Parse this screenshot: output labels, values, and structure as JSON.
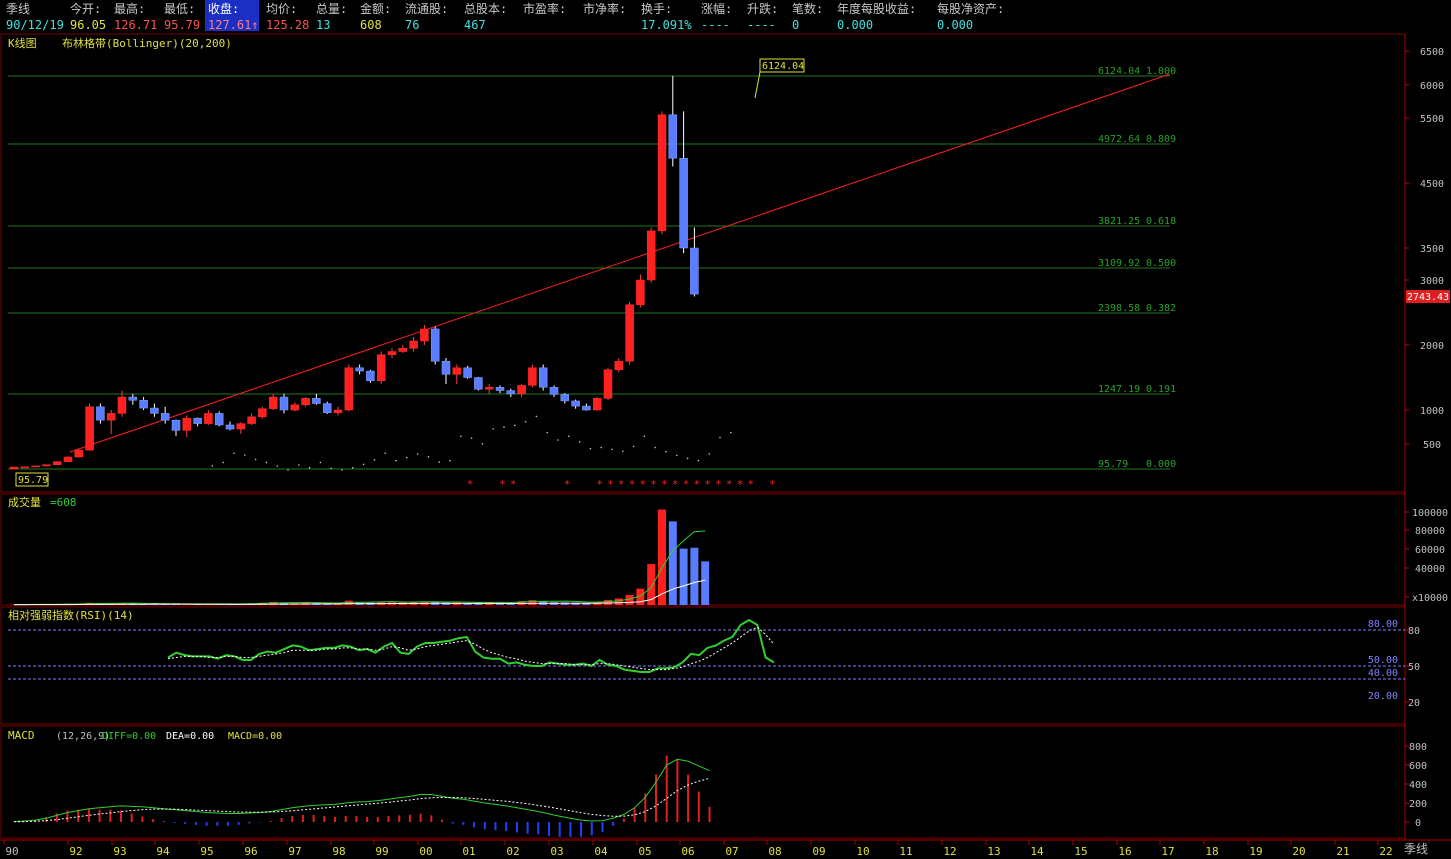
{
  "infobar": {
    "period_label": "季线",
    "fields": [
      {
        "label": "今开:",
        "value": "96.05",
        "color": "#e0e040"
      },
      {
        "label": "最高:",
        "value": "126.71",
        "color": "#ff5050"
      },
      {
        "label": "最低:",
        "value": "95.79",
        "color": "#ff5050"
      },
      {
        "label": "收盘:",
        "value": "127.61↑",
        "color": "#ff5050"
      },
      {
        "label": "均价:",
        "value": "125.28",
        "color": "#ff5050"
      },
      {
        "label": "总量:",
        "value": "13",
        "color": "#40e0e0"
      },
      {
        "label": "金额:",
        "value": "608",
        "color": "#e0e040"
      },
      {
        "label": "流通股:",
        "value": "76",
        "color": "#40e0e0"
      },
      {
        "label": "总股本:",
        "value": "467",
        "color": "#40e0e0"
      },
      {
        "label": "市盈率:",
        "value": "",
        "color": "#40e0e0"
      },
      {
        "label": "市净率:",
        "value": "",
        "color": "#40e0e0"
      },
      {
        "label": "换手:",
        "value": "17.091%",
        "color": "#40e0e0"
      },
      {
        "label": "涨幅:",
        "value": "----",
        "color": "#40e0e0"
      },
      {
        "label": "升跌:",
        "value": "----",
        "color": "#40e0e0"
      },
      {
        "label": "笔数:",
        "value": "0",
        "color": "#40e0e0"
      },
      {
        "label": "年度每股收益:",
        "value": "0.000",
        "color": "#40e0e0"
      },
      {
        "label": "每股净资产:",
        "value": "0.000",
        "color": "#40e0e0"
      }
    ],
    "date": "90/12/19"
  },
  "panels": {
    "kline": {
      "title": "K线图",
      "indicator": "布林格带(Bollinger)(20,200)"
    },
    "volume": {
      "title": "成交量",
      "value": "=608"
    },
    "rsi": {
      "title": "相对强弱指数(RSI)(14)"
    },
    "macd": {
      "title": "MACD",
      "params": "(12,26,9)",
      "diff": "DIFF=0.00",
      "dea": "DEA=0.00",
      "macd": "MACD=0.00"
    }
  },
  "colors": {
    "up": "#ff2020",
    "down": "#5a7cff",
    "trendline": "#ff2020",
    "fib": "#1e7a1e",
    "fib_text": "#2aa02a",
    "axis": "#c0c0c0",
    "rsi_line": "#30d030",
    "grid": "#8080ff"
  },
  "chart_data": [
    {
      "type": "candlestick",
      "name": "kline",
      "x_labels": [
        "90",
        "92",
        "93",
        "94",
        "95",
        "96",
        "97",
        "98",
        "99",
        "00",
        "01",
        "02",
        "03",
        "04",
        "05",
        "06",
        "07",
        "08",
        "09",
        "10",
        "11",
        "12",
        "13",
        "14",
        "15",
        "16",
        "17",
        "18",
        "19",
        "20",
        "21",
        "22"
      ],
      "y_ticks": [
        "6500",
        "6000",
        "5500",
        "4500",
        "3500",
        "3000",
        "2000",
        "1000",
        "500"
      ],
      "price_label": "2743.43",
      "high_label": "6124.04",
      "low_label": "95.79",
      "fib_levels": [
        {
          "value": 6124.04,
          "label": "6124.04",
          "ratio": "1.000"
        },
        {
          "value": 4972.64,
          "label": "4972.64",
          "ratio": "0.809"
        },
        {
          "value": 3821.25,
          "label": "3821.25",
          "ratio": "0.618"
        },
        {
          "value": 3109.92,
          "label": "3109.92",
          "ratio": "0.500"
        },
        {
          "value": 2398.58,
          "label": "2398.58",
          "ratio": "0.382"
        },
        {
          "value": 1247.19,
          "label": "1247.19",
          "ratio": "0.191"
        },
        {
          "value": 95.79,
          "label": "95.79",
          "ratio": "0.000"
        }
      ],
      "candles": [
        [
          96,
          127,
          96,
          128
        ],
        [
          128,
          135,
          125,
          130
        ],
        [
          130,
          150,
          128,
          145
        ],
        [
          145,
          170,
          140,
          165
        ],
        [
          165,
          220,
          160,
          215
        ],
        [
          215,
          300,
          210,
          290
        ],
        [
          290,
          420,
          280,
          400
        ],
        [
          400,
          1100,
          390,
          1050
        ],
        [
          1050,
          1100,
          800,
          850
        ],
        [
          850,
          1000,
          650,
          950
        ],
        [
          950,
          1300,
          900,
          1200
        ],
        [
          1200,
          1250,
          1080,
          1150
        ],
        [
          1150,
          1200,
          1000,
          1030
        ],
        [
          1030,
          1100,
          900,
          950
        ],
        [
          950,
          1050,
          800,
          850
        ],
        [
          850,
          860,
          620,
          700
        ],
        [
          700,
          920,
          600,
          880
        ],
        [
          880,
          890,
          760,
          800
        ],
        [
          800,
          1000,
          780,
          950
        ],
        [
          950,
          980,
          760,
          780
        ],
        [
          780,
          830,
          700,
          720
        ],
        [
          720,
          820,
          650,
          800
        ],
        [
          800,
          950,
          780,
          900
        ],
        [
          900,
          1050,
          870,
          1020
        ],
        [
          1020,
          1250,
          1000,
          1200
        ],
        [
          1200,
          1250,
          950,
          1000
        ],
        [
          1000,
          1120,
          980,
          1080
        ],
        [
          1080,
          1200,
          1050,
          1180
        ],
        [
          1180,
          1250,
          1080,
          1100
        ],
        [
          1100,
          1130,
          940,
          960
        ],
        [
          960,
          1050,
          920,
          1000
        ],
        [
          1000,
          1700,
          980,
          1650
        ],
        [
          1650,
          1700,
          1550,
          1600
        ],
        [
          1600,
          1620,
          1420,
          1450
        ],
        [
          1450,
          1900,
          1400,
          1850
        ],
        [
          1850,
          1950,
          1800,
          1900
        ],
        [
          1900,
          2000,
          1880,
          1950
        ],
        [
          1950,
          2100,
          1900,
          2050
        ],
        [
          2050,
          2250,
          2000,
          2200
        ],
        [
          2200,
          2230,
          1700,
          1750
        ],
        [
          1750,
          1800,
          1400,
          1550
        ],
        [
          1550,
          1700,
          1400,
          1650
        ],
        [
          1650,
          1680,
          1480,
          1500
        ],
        [
          1500,
          1510,
          1300,
          1320
        ],
        [
          1320,
          1400,
          1250,
          1350
        ],
        [
          1350,
          1380,
          1260,
          1300
        ],
        [
          1300,
          1330,
          1200,
          1250
        ],
        [
          1250,
          1400,
          1200,
          1380
        ],
        [
          1380,
          1700,
          1350,
          1650
        ],
        [
          1650,
          1700,
          1300,
          1350
        ],
        [
          1350,
          1380,
          1200,
          1240
        ],
        [
          1240,
          1260,
          1100,
          1140
        ],
        [
          1140,
          1160,
          1020,
          1060
        ],
        [
          1060,
          1100,
          990,
          1000
        ],
        [
          1000,
          1200,
          990,
          1180
        ],
        [
          1180,
          1650,
          1150,
          1620
        ],
        [
          1620,
          1800,
          1580,
          1750
        ],
        [
          1750,
          2600,
          1700,
          2550
        ],
        [
          2550,
          3050,
          2500,
          3000
        ],
        [
          3000,
          3800,
          2950,
          3750
        ],
        [
          3750,
          5600,
          3700,
          5550
        ],
        [
          5550,
          6124,
          4700,
          4800
        ],
        [
          4800,
          5600,
          3400,
          3500
        ],
        [
          3500,
          3800,
          2700,
          2743
        ]
      ],
      "stars_label": "*"
    },
    {
      "type": "bar",
      "name": "volume",
      "y_ticks": [
        "100000",
        "80000",
        "60000",
        "40000",
        "x10000"
      ],
      "values": [
        500,
        600,
        700,
        800,
        900,
        1100,
        1300,
        2500,
        1800,
        1500,
        1900,
        1600,
        1300,
        1200,
        1100,
        1000,
        1200,
        1000,
        1300,
        1100,
        1000,
        1500,
        1800,
        2600,
        3400,
        2200,
        1900,
        2300,
        2100,
        1900,
        1800,
        4800,
        3000,
        2600,
        3500,
        3200,
        2900,
        3100,
        3500,
        3300,
        2500,
        2700,
        2200,
        2600,
        2900,
        2700,
        2400,
        4200,
        5300,
        3900,
        3100,
        2900,
        2800,
        2400,
        3100,
        5600,
        7200,
        11000,
        18000,
        45000,
        105000,
        92000,
        62000,
        63000,
        48000
      ]
    },
    {
      "type": "line",
      "name": "rsi",
      "y_ticks": [
        "80",
        "50",
        "20"
      ],
      "ref_levels": [
        "80.00",
        "50.00",
        "40.00",
        "20.00"
      ],
      "values": [
        57,
        61,
        59,
        58,
        58,
        58,
        56,
        59,
        58,
        55,
        55,
        60,
        62,
        61,
        64,
        67,
        66,
        63,
        64,
        65,
        65,
        67,
        66,
        63,
        64,
        61,
        66,
        69,
        61,
        60,
        66,
        69,
        69,
        70,
        71,
        73,
        74,
        62,
        57,
        56,
        56,
        52,
        53,
        51,
        50,
        50,
        53,
        52,
        51,
        51,
        52,
        50,
        55,
        51,
        50,
        47,
        46,
        45,
        45,
        48,
        48,
        49,
        53,
        60,
        59,
        65,
        67,
        71,
        74,
        84,
        88,
        84,
        57,
        53
      ],
      "signal": [
        56,
        57,
        58,
        58,
        58,
        57,
        57,
        58,
        58,
        57,
        57,
        58,
        59,
        60,
        61,
        63,
        63,
        63,
        63,
        64,
        64,
        65,
        65,
        64,
        64,
        63,
        64,
        66,
        65,
        63,
        64,
        66,
        67,
        68,
        69,
        70,
        71,
        68,
        64,
        61,
        59,
        57,
        56,
        54,
        53,
        52,
        52,
        52,
        52,
        51,
        51,
        51,
        52,
        52,
        51,
        50,
        49,
        48,
        47,
        47,
        47,
        48,
        49,
        52,
        54,
        57,
        61,
        65,
        69,
        74,
        79,
        82,
        76,
        68
      ]
    },
    {
      "type": "bar",
      "name": "macd",
      "y_ticks": [
        "800",
        "600",
        "400",
        "200",
        "0"
      ],
      "diff": [
        5,
        10,
        20,
        40,
        70,
        100,
        120,
        140,
        150,
        160,
        170,
        165,
        160,
        150,
        140,
        130,
        120,
        110,
        100,
        95,
        90,
        90,
        95,
        100,
        110,
        130,
        150,
        165,
        175,
        180,
        185,
        200,
        210,
        215,
        225,
        240,
        255,
        270,
        290,
        290,
        270,
        250,
        240,
        220,
        200,
        185,
        170,
        150,
        130,
        110,
        85,
        60,
        40,
        20,
        10,
        15,
        40,
        80,
        150,
        260,
        420,
        600,
        660,
        640,
        590,
        540
      ],
      "dea": [
        2,
        4,
        8,
        15,
        25,
        40,
        55,
        70,
        85,
        95,
        110,
        120,
        130,
        135,
        135,
        135,
        130,
        125,
        120,
        115,
        110,
        105,
        103,
        103,
        105,
        110,
        118,
        128,
        138,
        148,
        158,
        168,
        178,
        188,
        198,
        208,
        220,
        232,
        246,
        255,
        258,
        258,
        255,
        248,
        238,
        228,
        218,
        205,
        192,
        175,
        158,
        138,
        118,
        98,
        80,
        68,
        60,
        62,
        75,
        110,
        170,
        250,
        330,
        390,
        430,
        460
      ],
      "hist": [
        6,
        12,
        24,
        50,
        90,
        120,
        130,
        140,
        130,
        130,
        120,
        90,
        60,
        30,
        10,
        -10,
        -20,
        -30,
        -40,
        -40,
        -40,
        -30,
        -16,
        -6,
        10,
        40,
        64,
        74,
        74,
        64,
        54,
        64,
        64,
        54,
        54,
        64,
        70,
        76,
        88,
        70,
        24,
        -16,
        -30,
        -56,
        -76,
        -86,
        -96,
        -110,
        -124,
        -130,
        -146,
        -156,
        -156,
        -156,
        -140,
        -106,
        -40,
        36,
        150,
        300,
        500,
        700,
        660,
        500,
        320,
        160
      ]
    }
  ]
}
